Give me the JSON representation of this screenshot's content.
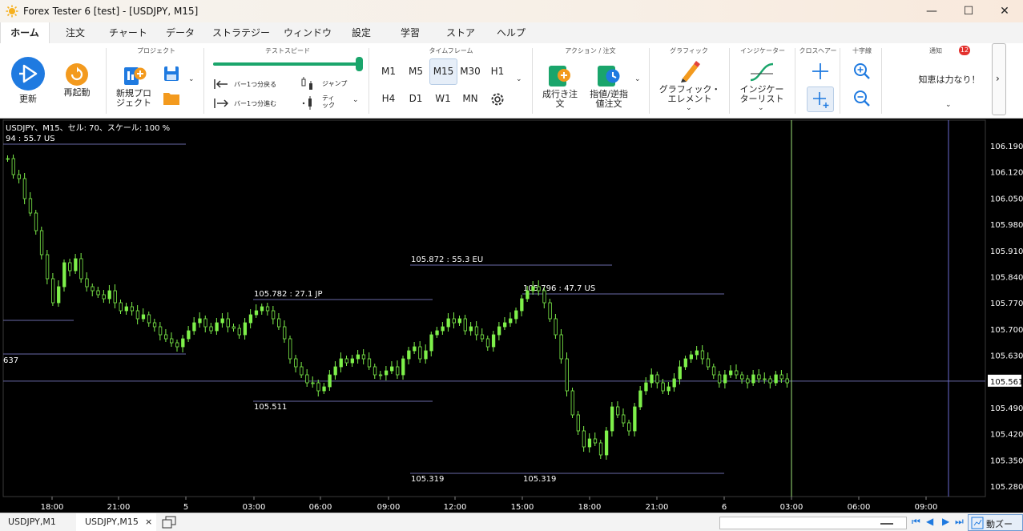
{
  "window": {
    "title": "Forex Tester 6  [test] - [USDJPY, M15]",
    "minimize": "—",
    "maximize": "☐",
    "close": "✕"
  },
  "menu": {
    "tabs": [
      "ホーム",
      "注文",
      "チャート",
      "データ",
      "ストラテジー",
      "ウィンドウ",
      "設定",
      "学習",
      "ストア",
      "ヘルプ"
    ],
    "active": "ホーム"
  },
  "ribbon": {
    "update_label": "更新",
    "restart_label": "再起動",
    "project_group": "プロジェクト",
    "new_project_label": "新規プロ\nジェクト",
    "test_speed_group": "テストスピード",
    "back_one_bar": "バー1つ分戻る",
    "forward_one_bar": "バー1つ分進む",
    "jump": "ジャンプ",
    "tick": "ティ\nック",
    "timeframe_group": "タイムフレーム",
    "timeframes": [
      "M1",
      "M5",
      "M15",
      "M30",
      "H1",
      "H4",
      "D1",
      "W1",
      "MN"
    ],
    "active_timeframe": "M15",
    "action_group": "アクション / 注文",
    "market_order": "成行き注\n文",
    "limit_stop_order": "指値/逆指\n値注文",
    "graphic_group": "グラフィック",
    "graphic_elements": "グラフィック・\nエレメント",
    "indicator_group": "インジケーター",
    "indicator_list": "インジケー\nターリスト",
    "crosshair_group": "クロスヘアー",
    "crosshair_tool_group": "十字線",
    "notice_group": "通知",
    "notice_count": "12",
    "notice_text": "知恵は力なり！",
    "colors": {
      "accent": "#1f7ae0",
      "orange": "#f39a1e",
      "green": "#1aa56b"
    }
  },
  "chart": {
    "header": "USDJPY、M15、セル: 70、スケール: 100 %",
    "top_measure": "94 : 55.7 US",
    "left_edge_label": "637",
    "current_price": "105.561",
    "price_ticks": [
      "106.190",
      "106.120",
      "106.050",
      "105.980",
      "105.910",
      "105.840",
      "105.770",
      "105.700",
      "105.630",
      "105.561",
      "105.490",
      "105.420",
      "105.350",
      "105.280"
    ],
    "time_ticks": [
      "18:00",
      "21:00",
      "5",
      "03:00",
      "06:00",
      "09:00",
      "12:00",
      "15:00",
      "18:00",
      "21:00",
      "6",
      "03:00",
      "06:00",
      "09:00"
    ],
    "annotations": {
      "h1": "105.782 : 27.1 JP",
      "l1": "105.511",
      "h2": "105.872 : 55.3 EU",
      "h3": "105.796 : 47.7 US",
      "l2": "105.319",
      "l3": "105.319"
    },
    "candle_color": "#7ef04a",
    "grid_line_color": "#6a6aa8"
  },
  "bottom": {
    "tab1": "USDJPY,M1",
    "tab2": "USDJPY,M15",
    "tab2_close": "×",
    "zoom_label": "動ズー"
  }
}
